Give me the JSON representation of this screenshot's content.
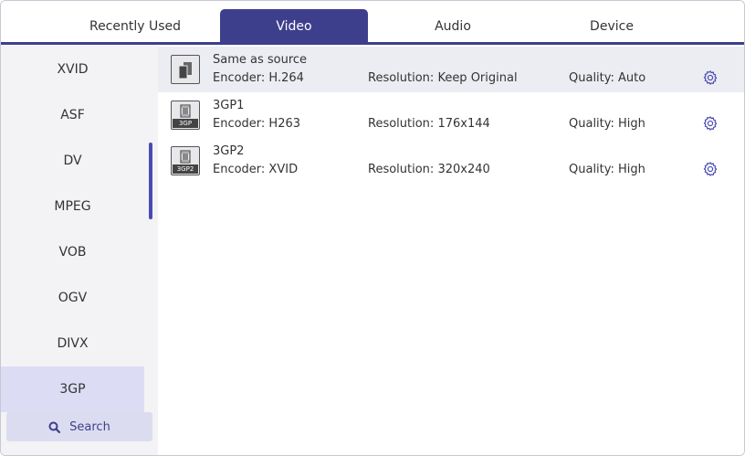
{
  "tabs": [
    {
      "label": "Recently Used",
      "active": false
    },
    {
      "label": "Video",
      "active": true
    },
    {
      "label": "Audio",
      "active": false
    },
    {
      "label": "Device",
      "active": false
    }
  ],
  "sidebar": {
    "items": [
      {
        "label": "XVID"
      },
      {
        "label": "ASF"
      },
      {
        "label": "DV"
      },
      {
        "label": "MPEG"
      },
      {
        "label": "VOB"
      },
      {
        "label": "OGV"
      },
      {
        "label": "DIVX"
      },
      {
        "label": "3GP",
        "selected": true
      }
    ],
    "search_label": "Search"
  },
  "presets": [
    {
      "name": "Same as source",
      "encoder": "Encoder: H.264",
      "resolution": "Resolution: Keep Original",
      "quality": "Quality: Auto",
      "icon": "copy-source-icon",
      "selected": true
    },
    {
      "name": "3GP1",
      "encoder": "Encoder: H263",
      "resolution": "Resolution: 176x144",
      "quality": "Quality: High",
      "icon": "film-3gp-icon",
      "badge": "3GP"
    },
    {
      "name": "3GP2",
      "encoder": "Encoder: XVID",
      "resolution": "Resolution: 320x240",
      "quality": "Quality: High",
      "icon": "film-3gp2-icon",
      "badge": "3GP2"
    }
  ],
  "colors": {
    "accent": "#3e3f8c",
    "sidebar_bg": "#f3f3f6",
    "selected_bg": "#dcdcf5",
    "gear": "#4a4bb0"
  }
}
